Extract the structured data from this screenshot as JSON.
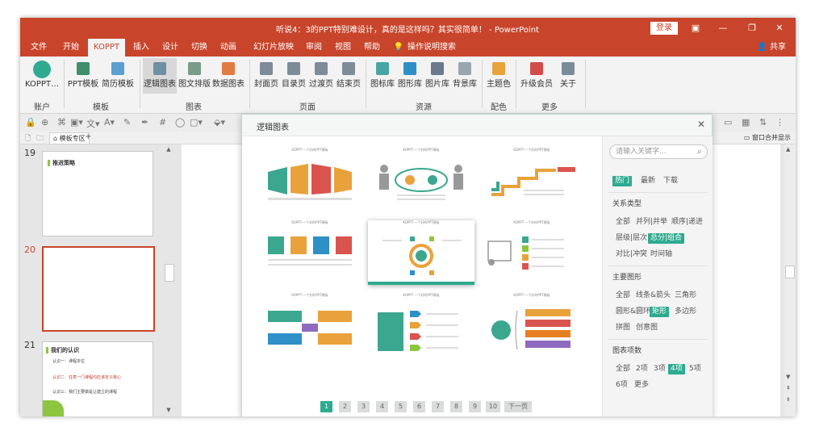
{
  "window": {
    "title": "听说4：3的PPT特别难设计，真的是这样吗？其实很简单！ - PowerPoint",
    "login": "登录",
    "controls": {
      "ribbon_opts": "▣",
      "minimize": "—",
      "restore": "❐",
      "close": "✕"
    }
  },
  "menu": {
    "items": [
      "文件",
      "开始",
      "KOPPT",
      "插入",
      "设计",
      "切换",
      "动画",
      "幻灯片放映",
      "审阅",
      "视图",
      "帮助",
      "操作说明搜索"
    ],
    "active_index": 2,
    "share": "共享"
  },
  "ribbon": {
    "buttons": [
      {
        "label": "KOPPT…",
        "color": "#2eaa8f"
      },
      {
        "label": "PPT模板",
        "color": "#3f8e6b"
      },
      {
        "label": "简历模板",
        "color": "#5a9fcf"
      },
      {
        "label": "逻辑图表",
        "color": "#6f8fa3"
      },
      {
        "label": "图文排版",
        "color": "#7a9a8a"
      },
      {
        "label": "数据图表",
        "color": "#e07b45"
      },
      {
        "label": "封面页",
        "color": "#7d8c98"
      },
      {
        "label": "目录页",
        "color": "#7d8c98"
      },
      {
        "label": "过渡页",
        "color": "#7d8c98"
      },
      {
        "label": "结束页",
        "color": "#7d8c98"
      },
      {
        "label": "图标库",
        "color": "#47a6a3"
      },
      {
        "label": "图形库",
        "color": "#2f8fc7"
      },
      {
        "label": "图片库",
        "color": "#6a7a8a"
      },
      {
        "label": "背景库",
        "color": "#9aa6ae"
      },
      {
        "label": "主题色",
        "color": "#e8a33a"
      },
      {
        "label": "升级会员",
        "color": "#d24b4b"
      },
      {
        "label": "关于",
        "color": "#7a8c9a"
      }
    ],
    "groups": [
      "账户",
      "模板",
      "图表",
      "页面",
      "资源",
      "配色",
      "更多"
    ]
  },
  "tabs": {
    "template_tab": "模板专区",
    "window_merge": "窗口合并显示"
  },
  "slides": [
    {
      "num": "19",
      "title": "推进策略"
    },
    {
      "num": "20",
      "title": ""
    },
    {
      "num": "21",
      "title": "我们的认识",
      "lines": [
        "认识一：课程本位",
        "认识二：任意一门课程均应该定义核心",
        "认识三：我们主要做是让建立的课程"
      ]
    }
  ],
  "dialog": {
    "title": "逻辑图表",
    "close": "✕",
    "card_caption": "KOPPT·一个好的PPT模板",
    "pages": [
      "1",
      "2",
      "3",
      "4",
      "5",
      "6",
      "7",
      "8",
      "9",
      "10"
    ],
    "active_page": "1",
    "next_label": "下一页",
    "search_placeholder": "请输入关键字...",
    "sort_tabs": [
      {
        "label": "热门",
        "active": true
      },
      {
        "label": "最新",
        "active": false
      },
      {
        "label": "下载",
        "active": false
      }
    ],
    "sections": [
      {
        "title": "关系类型",
        "rows": [
          [
            {
              "label": "全部",
              "active": false
            },
            {
              "label": "并列|并举",
              "active": false
            },
            {
              "label": "顺序|递进",
              "active": false
            }
          ],
          [
            {
              "label": "层级|层次",
              "active": false
            },
            {
              "label": "总分|组合",
              "active": true
            }
          ],
          [
            {
              "label": "对比|冲突",
              "active": false
            },
            {
              "label": "时间轴",
              "active": false
            }
          ]
        ]
      },
      {
        "title": "主要图形",
        "rows": [
          [
            {
              "label": "全部",
              "active": false
            },
            {
              "label": "线条&箭头",
              "active": false
            },
            {
              "label": "三角形",
              "active": false
            }
          ],
          [
            {
              "label": "圆形&圆环",
              "active": false
            },
            {
              "label": "矩形",
              "active": true
            },
            {
              "label": "多边形",
              "active": false
            }
          ],
          [
            {
              "label": "拼图",
              "active": false
            },
            {
              "label": "创意图",
              "active": false
            }
          ]
        ]
      },
      {
        "title": "图表项数",
        "rows": [
          [
            {
              "label": "全部",
              "active": false
            },
            {
              "label": "2项",
              "active": false
            },
            {
              "label": "3项",
              "active": false
            },
            {
              "label": "4项",
              "active": true
            },
            {
              "label": "5项",
              "active": false
            }
          ],
          [
            {
              "label": "6项",
              "active": false
            },
            {
              "label": "更多",
              "active": false
            }
          ]
        ]
      }
    ]
  }
}
